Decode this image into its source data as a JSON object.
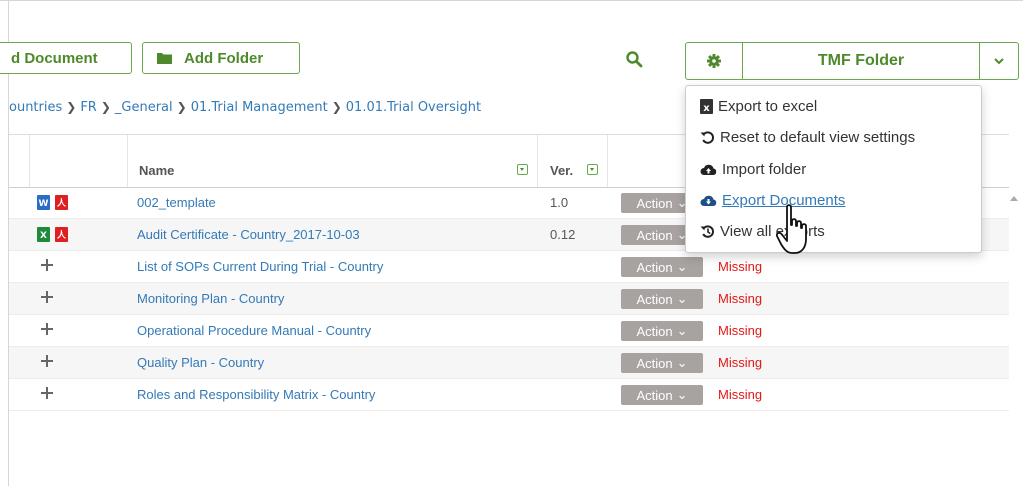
{
  "toolbar": {
    "add_document_label": "d Document",
    "add_folder_label": "Add Folder",
    "tmf_folder_label": "TMF Folder"
  },
  "breadcrumb": [
    "ountries",
    "FR",
    "_General",
    "01.Trial Management",
    "01.01.Trial Oversight"
  ],
  "table": {
    "headers": {
      "name": "Name",
      "ver": "Ver."
    },
    "rows": [
      {
        "icons": [
          "word-icon",
          "pdf-icon"
        ],
        "name": "002_template",
        "ver": "1.0",
        "action": "Action",
        "status": ""
      },
      {
        "icons": [
          "excel-icon",
          "pdf-icon"
        ],
        "name": "Audit Certificate - Country_2017-10-03",
        "ver": "0.12",
        "action": "Action",
        "status": ""
      },
      {
        "icons": [
          "plus-icon"
        ],
        "name": "List of SOPs Current During Trial - Country",
        "ver": "",
        "action": "Action",
        "status": "Missing"
      },
      {
        "icons": [
          "plus-icon"
        ],
        "name": "Monitoring Plan - Country",
        "ver": "",
        "action": "Action",
        "status": "Missing"
      },
      {
        "icons": [
          "plus-icon"
        ],
        "name": "Operational Procedure Manual - Country",
        "ver": "",
        "action": "Action",
        "status": "Missing"
      },
      {
        "icons": [
          "plus-icon"
        ],
        "name": "Quality Plan - Country",
        "ver": "",
        "action": "Action",
        "status": "Missing"
      },
      {
        "icons": [
          "plus-icon"
        ],
        "name": "Roles and Responsibility Matrix - Country",
        "ver": "",
        "action": "Action",
        "status": "Missing"
      }
    ]
  },
  "dropdown": {
    "items": [
      {
        "icon": "excel-icon",
        "label": "Export to excel"
      },
      {
        "icon": "reset-icon",
        "label": "Reset to default view settings"
      },
      {
        "icon": "cloud-upload-icon",
        "label": "Import folder"
      },
      {
        "icon": "cloud-download-icon",
        "label": "Export Documents"
      },
      {
        "icon": "history-icon",
        "label": "View all exports"
      }
    ],
    "hovered_index": 3
  },
  "colors": {
    "accent_green": "#6aa84f",
    "link_blue": "#337ab7",
    "missing_red": "#e01818",
    "action_gray": "#a8a2a0"
  }
}
